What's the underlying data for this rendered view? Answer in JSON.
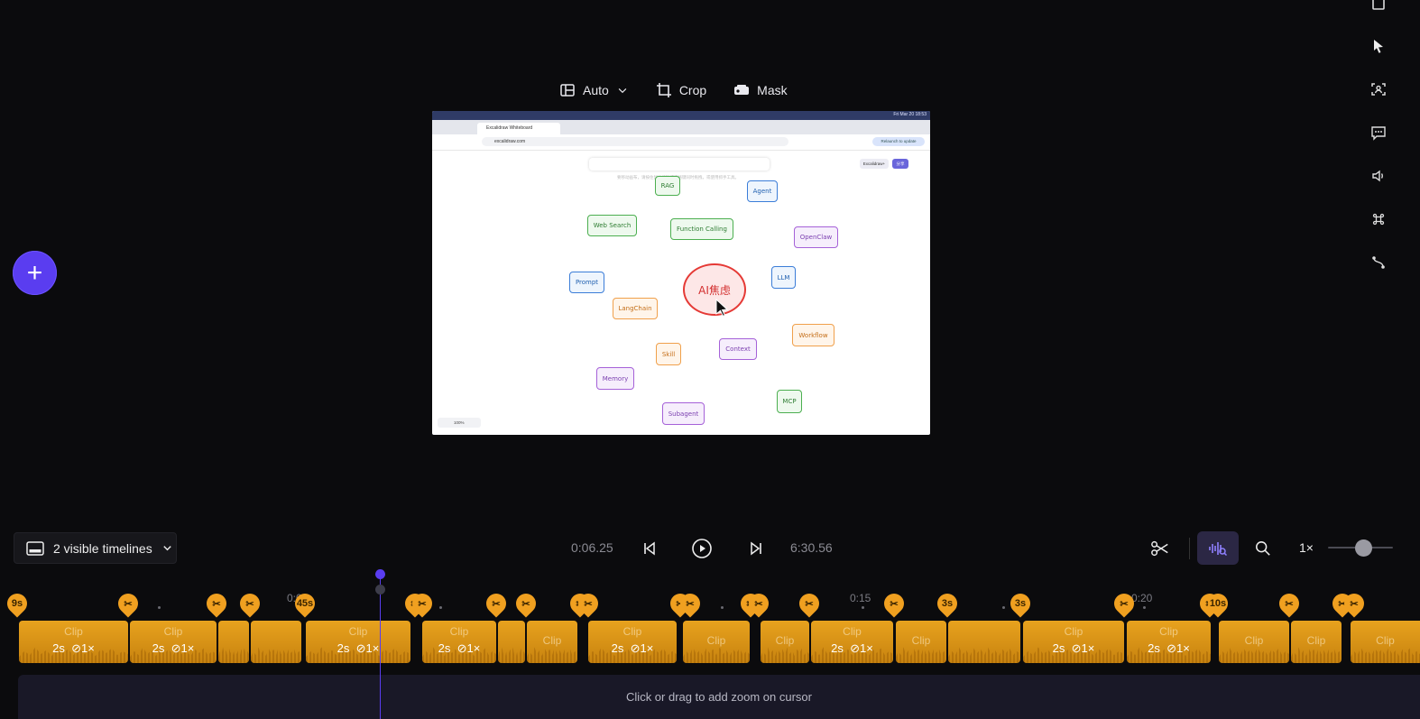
{
  "toolbar": {
    "layout_label": "Auto",
    "crop_label": "Crop",
    "mask_label": "Mask"
  },
  "preview": {
    "tab_title": "Excalidraw Whiteboard",
    "url": "excalidraw.com",
    "relaunch": "Relaunch to update",
    "menubar_time": "Fri Mar 20 18:53",
    "zoom": "100%",
    "exc_label": "Excalidraw+",
    "share_label": "分享",
    "hint": "要移动画布，请按住鼠标滚轮或空格键同时拖拽，或使用抓手工具。",
    "center_label": "AI焦虑",
    "nodes": {
      "rag": "RAG",
      "agent": "Agent",
      "web_search": "Web Search",
      "function_calling": "Function Calling",
      "openclaw": "OpenClaw",
      "prompt": "Prompt",
      "llm": "LLM",
      "langchain": "LangChain",
      "workflow": "Workflow",
      "skill": "Skill",
      "context": "Context",
      "memory": "Memory",
      "mcp": "MCP",
      "subagent": "Subagent"
    }
  },
  "playback": {
    "visible_timelines": "2 visible timelines",
    "current_time": "0:06.25",
    "total_time": "6:30.56",
    "speed": "1×",
    "zoom_level": 0.45
  },
  "timeline": {
    "ruler": [
      "0:05",
      "0:15",
      "0:20"
    ],
    "markers": [
      "9s",
      "45s",
      "3s",
      "3s",
      "10s"
    ],
    "clip_label": "Clip",
    "clip_duration": "2s",
    "clip_speed": "1×",
    "zoom_hint": "Click or drag to add zoom on cursor"
  },
  "colors": {
    "accent": "#5a3df0",
    "clip": "#e8a21e",
    "background": "#0b0b0d"
  }
}
